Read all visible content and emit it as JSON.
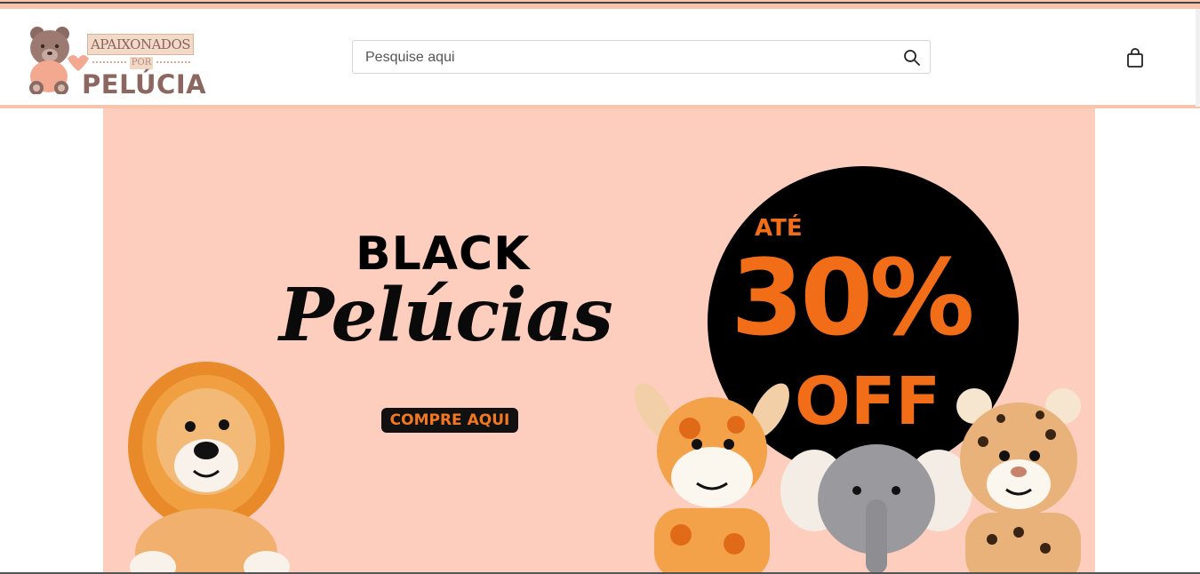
{
  "header": {
    "logo": {
      "line1": "APAIXONADOS",
      "line2": "POR",
      "line3": "PELÚCIA"
    },
    "search": {
      "placeholder": "Pesquise aqui",
      "value": ""
    },
    "icons": {
      "search": "search-icon",
      "cart": "shopping-bag-icon"
    }
  },
  "banner": {
    "title_top": "BLACK",
    "title_script": "Pelúcias",
    "cta_label": "COMPRE AQUI",
    "promo_prefix": "ATÉ",
    "promo_value": "30%",
    "promo_suffix": "OFF",
    "colors": {
      "background": "#fdcdbd",
      "accent": "#f26d18",
      "brand_stripe": "#f7c4ac"
    }
  }
}
